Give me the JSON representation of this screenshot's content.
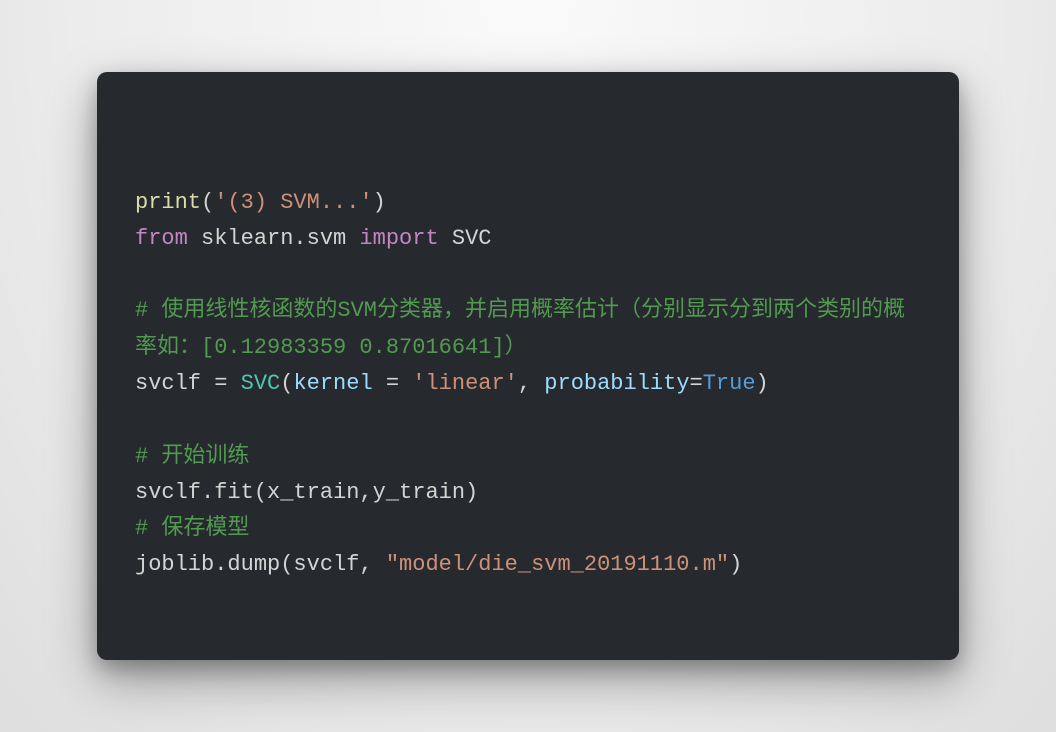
{
  "code": {
    "tokens": [
      {
        "cls": "tok-fn",
        "t": "print"
      },
      {
        "cls": "tok-plain",
        "t": "("
      },
      {
        "cls": "tok-str",
        "t": "'(3) SVM...'"
      },
      {
        "cls": "tok-plain",
        "t": ")\n"
      },
      {
        "cls": "tok-keyword",
        "t": "from"
      },
      {
        "cls": "tok-plain",
        "t": " "
      },
      {
        "cls": "tok-module",
        "t": "sklearn.svm"
      },
      {
        "cls": "tok-plain",
        "t": " "
      },
      {
        "cls": "tok-keyword",
        "t": "import"
      },
      {
        "cls": "tok-plain",
        "t": " "
      },
      {
        "cls": "tok-module",
        "t": "SVC"
      },
      {
        "cls": "tok-plain",
        "t": "\n\n"
      },
      {
        "cls": "tok-comment",
        "t": "# 使用线性核函数的SVM分类器，并启用概率估计（分别显示分到两个类别的概率如：[0.12983359 0.87016641]）"
      },
      {
        "cls": "tok-plain",
        "t": "\n"
      },
      {
        "cls": "tok-var",
        "t": "svclf = "
      },
      {
        "cls": "tok-class",
        "t": "SVC"
      },
      {
        "cls": "tok-plain",
        "t": "("
      },
      {
        "cls": "tok-param",
        "t": "kernel"
      },
      {
        "cls": "tok-plain",
        "t": " = "
      },
      {
        "cls": "tok-str",
        "t": "'linear'"
      },
      {
        "cls": "tok-plain",
        "t": ", "
      },
      {
        "cls": "tok-param",
        "t": "probability"
      },
      {
        "cls": "tok-plain",
        "t": "="
      },
      {
        "cls": "tok-bool",
        "t": "True"
      },
      {
        "cls": "tok-plain",
        "t": ")\n\n"
      },
      {
        "cls": "tok-comment",
        "t": "# 开始训练"
      },
      {
        "cls": "tok-plain",
        "t": "\n"
      },
      {
        "cls": "tok-var",
        "t": "svclf.fit(x_train,y_train)\n"
      },
      {
        "cls": "tok-comment",
        "t": "# 保存模型"
      },
      {
        "cls": "tok-plain",
        "t": "\n"
      },
      {
        "cls": "tok-var",
        "t": "joblib.dump(svclf, "
      },
      {
        "cls": "tok-str",
        "t": "\"model/die_svm_20191110.m\""
      },
      {
        "cls": "tok-plain",
        "t": ")"
      }
    ]
  }
}
